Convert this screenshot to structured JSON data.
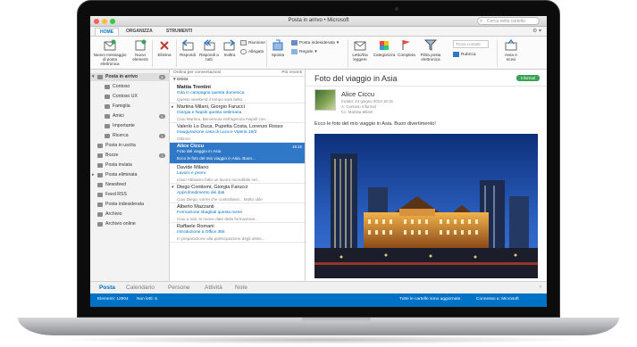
{
  "window": {
    "title": "Posta in arrivo • Microsoft",
    "search_placeholder": "Cerca nella cartella"
  },
  "ribbon_tabs": [
    "HOME",
    "ORGANIZZA",
    "STRUMENTI"
  ],
  "ribbon": {
    "new_email": "Nuovo messaggio di posta elettronica",
    "new_items": "Nuovi elementi",
    "delete": "Elimina",
    "reply": "Rispondi",
    "reply_all": "Rispondi a tutti",
    "forward": "Inoltra",
    "meeting": "Riunione",
    "attachment": "Allegato",
    "move": "Sposta",
    "junk": "Posta indesiderata",
    "rules": "Regole",
    "read_unread": "Letto/Da leggere",
    "categorize": "Categorizza",
    "follow_up": "Completa",
    "filter": "Filtra posta elettronica",
    "find_contact": "Trova contatti",
    "address_book": "Rubrica",
    "send_receive": "Invia e ricevi"
  },
  "folders": [
    {
      "label": "Posta in arrivo",
      "badge": "6",
      "level": 0,
      "selected": true,
      "caret": "▾"
    },
    {
      "label": "Contoso",
      "badge": "",
      "level": 1
    },
    {
      "label": "Contoso UX",
      "badge": "",
      "level": 1
    },
    {
      "label": "Famiglia",
      "badge": "",
      "level": 1
    },
    {
      "label": "Amici",
      "badge": "6",
      "level": 1
    },
    {
      "label": "Importante",
      "badge": "",
      "level": 1
    },
    {
      "label": "Ricerca",
      "badge": "1",
      "level": 1
    },
    {
      "label": "Posta in uscita",
      "badge": "",
      "level": 0
    },
    {
      "label": "Bozze",
      "badge": "3",
      "level": 0
    },
    {
      "label": "Posta inviata",
      "badge": "",
      "level": 0
    },
    {
      "label": "Posta eliminata",
      "badge": "",
      "level": 0,
      "caret": "▸"
    },
    {
      "label": "Newsfeed",
      "badge": "",
      "level": 0
    },
    {
      "label": "Feed RSS",
      "badge": "",
      "level": 0
    },
    {
      "label": "Posta indesiderata",
      "badge": "",
      "level": 0
    },
    {
      "label": "Archivio",
      "badge": "",
      "level": 0
    },
    {
      "label": "Archivio online",
      "badge": "",
      "level": 0
    }
  ],
  "list": {
    "sort_label": "Ordina per conversazioni",
    "recent_label": "Più recenti",
    "group_label": "▾ OGGI",
    "messages": [
      {
        "from": "Mattia Trentini",
        "subject": "Gita in campagna questa domenica",
        "preview": "Questo weekend il tempo sarà bello...",
        "time": "",
        "mark": ""
      },
      {
        "from": "Martina Milani, Giorgio Farucci",
        "subject": "Giorgia e Napoli questa settimana",
        "preview": "Ciao Martina, Benvenuta nell'agenzia Napoli con...",
        "time": "",
        "mark": "▸"
      },
      {
        "from": "Valerio Lo Duca, Pupetta Costa, Lorenzo Rosso",
        "subject": "Inaugurazione casa di Luca e Valeria 18/3",
        "preview": "Ottimo!",
        "time": "",
        "mark": ""
      },
      {
        "from": "Alice Ciccu",
        "subject": "Foto del viaggio in Asia",
        "preview": "Ecco le foto del mio viaggio in Asia. Buon...",
        "time": "16:15",
        "mark": ""
      },
      {
        "from": "Davide Milano",
        "subject": "Lavoro e premi",
        "preview": "Ciao! Abbiamo fatto un lavoro incredibile nel...",
        "time": "",
        "mark": ""
      },
      {
        "from": "Diego Contiomi, Giorgia Farucci",
        "subject": "Approfondimento dei dati",
        "preview": "Ciao Diego, vorrei che controllassi... Molto utile",
        "time": "",
        "mark": "▾"
      },
      {
        "from": "Alberto Mazzanti",
        "subject": "Formazione sbagliati questa mese",
        "preview": "Ciao a tutti, le nuove date della formazione...",
        "time": "",
        "mark": ""
      },
      {
        "from": "Raffaele Romani",
        "subject": "Introduzione a Office 365",
        "preview": "In preparazione alla partecipazione degli ultimi...",
        "time": "",
        "mark": ""
      }
    ]
  },
  "reading": {
    "title": "Foto del viaggio in Asia",
    "badge": "Informal",
    "sender": "Alice Ciccu",
    "date": "Inviato: 24 giugno 2013 16:15",
    "to": "A:  Contoso Informal",
    "cc": "Cc:  Martina Milani",
    "body": "Ecco le foto del mio viaggio in Asia. Buon divertimento!"
  },
  "nav": [
    "Posta",
    "Calendario",
    "Persone",
    "Attività",
    "Note"
  ],
  "status": {
    "items": "Elementi: 12904",
    "unread": "Non letti: 6",
    "sync": "Tutte le cartelle sono aggiornate.",
    "connection": "Connesso a: Microsoft"
  }
}
